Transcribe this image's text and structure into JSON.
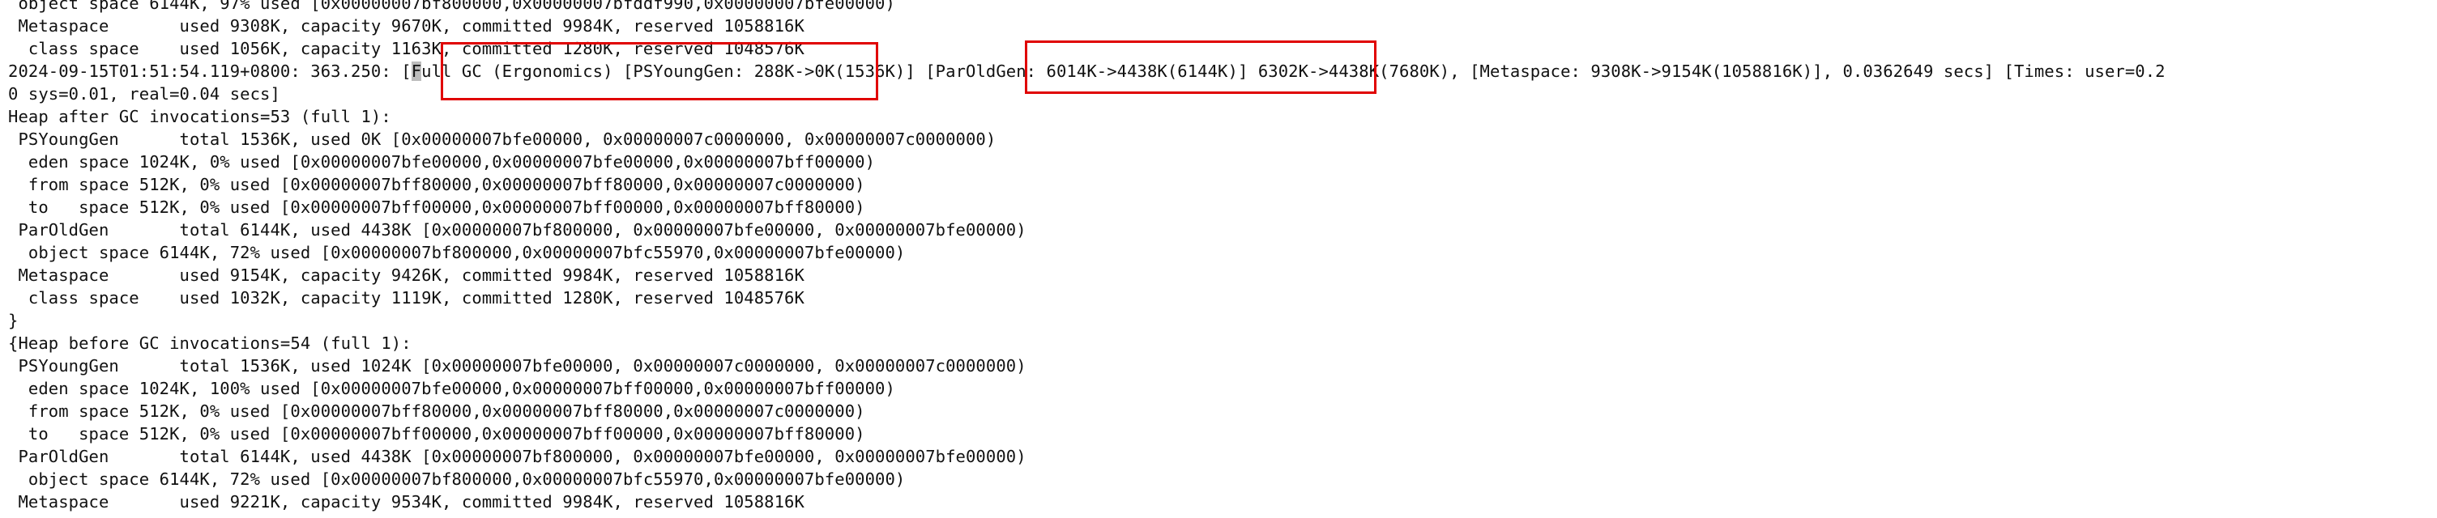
{
  "terminal": {
    "lines": [
      " object space 6144K, 97% used [0x00000007bf800000,0x00000007bfddf990,0x00000007bfe00000)",
      " Metaspace       used 9308K, capacity 9670K, committed 9984K, reserved 1058816K",
      "  class space    used 1056K, capacity 1163K, committed 1280K, reserved 1048576K",
      {
        "pre": "2024-09-15T01:51:54.119+0800: 363.250: [",
        "cursor": "F",
        "post": "ull GC (Ergonomics) [PSYoungGen: 288K->0K(1536K)] [ParOldGen: 6014K->4438K(6144K)] 6302K->4438K(7680K), [Metaspace: 9308K->9154K(1058816K)], 0.0362649 secs] [Times: user=0.2"
      },
      "0 sys=0.01, real=0.04 secs]",
      "Heap after GC invocations=53 (full 1):",
      " PSYoungGen      total 1536K, used 0K [0x00000007bfe00000, 0x00000007c0000000, 0x00000007c0000000)",
      "  eden space 1024K, 0% used [0x00000007bfe00000,0x00000007bfe00000,0x00000007bff00000)",
      "  from space 512K, 0% used [0x00000007bff80000,0x00000007bff80000,0x00000007c0000000)",
      "  to   space 512K, 0% used [0x00000007bff00000,0x00000007bff00000,0x00000007bff80000)",
      " ParOldGen       total 6144K, used 4438K [0x00000007bf800000, 0x00000007bfe00000, 0x00000007bfe00000)",
      "  object space 6144K, 72% used [0x00000007bf800000,0x00000007bfc55970,0x00000007bfe00000)",
      " Metaspace       used 9154K, capacity 9426K, committed 9984K, reserved 1058816K",
      "  class space    used 1032K, capacity 1119K, committed 1280K, reserved 1048576K",
      "}",
      "{Heap before GC invocations=54 (full 1):",
      " PSYoungGen      total 1536K, used 1024K [0x00000007bfe00000, 0x00000007c0000000, 0x00000007c0000000)",
      "  eden space 1024K, 100% used [0x00000007bfe00000,0x00000007bff00000,0x00000007bff00000)",
      "  from space 512K, 0% used [0x00000007bff80000,0x00000007bff80000,0x00000007c0000000)",
      "  to   space 512K, 0% used [0x00000007bff00000,0x00000007bff00000,0x00000007bff80000)",
      " ParOldGen       total 6144K, used 4438K [0x00000007bf800000, 0x00000007bfe00000, 0x00000007bfe00000)",
      "  object space 6144K, 72% used [0x00000007bf800000,0x00000007bfc55970,0x00000007bfe00000)",
      " Metaspace       used 9221K, capacity 9534K, committed 9984K, reserved 1058816K"
    ]
  },
  "annotations": {
    "color": "#e00000"
  }
}
